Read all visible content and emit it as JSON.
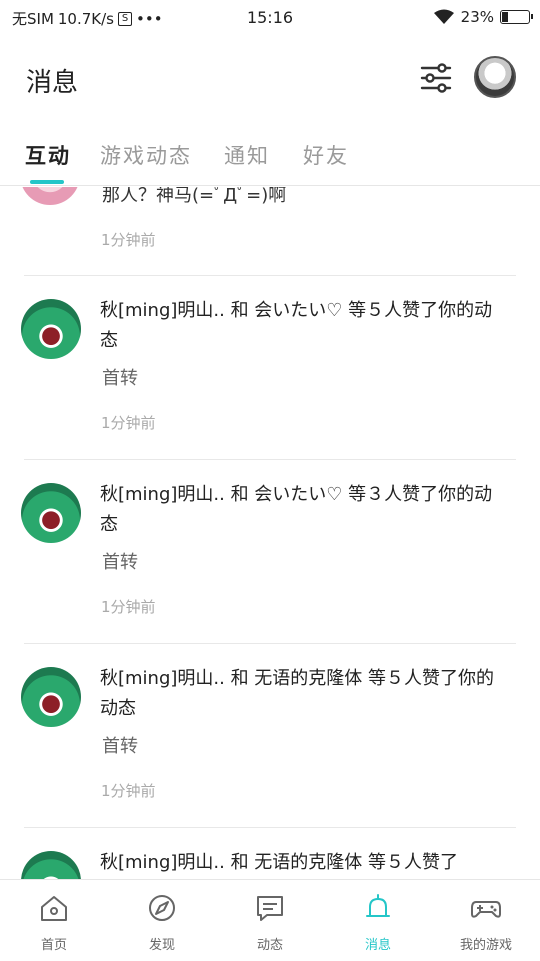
{
  "status_bar": {
    "carrier": "无SIM",
    "speed": "10.7K/s",
    "sim_icon_letter": "S",
    "dots": "•••",
    "time": "15:16",
    "battery": "23%",
    "battery_level": 0.23
  },
  "header": {
    "title": "消息"
  },
  "tabs": [
    {
      "label": "互动",
      "active": true
    },
    {
      "label": "游戏动态",
      "active": false
    },
    {
      "label": "通知",
      "active": false
    },
    {
      "label": "好友",
      "active": false
    }
  ],
  "partial_item": {
    "text": "那人？神马(=ﾟДﾟ=)啊",
    "time": "1分钟前"
  },
  "items": [
    {
      "text": "秋[ming]明山.. 和 会いたい♡ 等５人赞了你的动态",
      "quote": "首转",
      "time": "1分钟前"
    },
    {
      "text": "秋[ming]明山.. 和 会いたい♡ 等３人赞了你的动态",
      "quote": "首转",
      "time": "1分钟前"
    },
    {
      "text": "秋[ming]明山.. 和 无语的克隆体 等５人赞了你的动态",
      "quote": "首转",
      "time": "1分钟前"
    },
    {
      "text": "秋[ming]明山.. 和 无语的克隆体 等５人赞了",
      "quote": "",
      "time": ""
    }
  ],
  "bottom_nav": [
    {
      "label": "首页",
      "icon": "home-icon",
      "active": false
    },
    {
      "label": "发现",
      "icon": "discover-icon",
      "active": false
    },
    {
      "label": "动态",
      "icon": "feed-icon",
      "active": false
    },
    {
      "label": "消息",
      "icon": "bell-icon",
      "active": true
    },
    {
      "label": "我的游戏",
      "icon": "gamepad-icon",
      "active": false
    }
  ],
  "colors": {
    "accent": "#24c6c8",
    "text": "#222222",
    "muted": "#aaaaaa"
  }
}
